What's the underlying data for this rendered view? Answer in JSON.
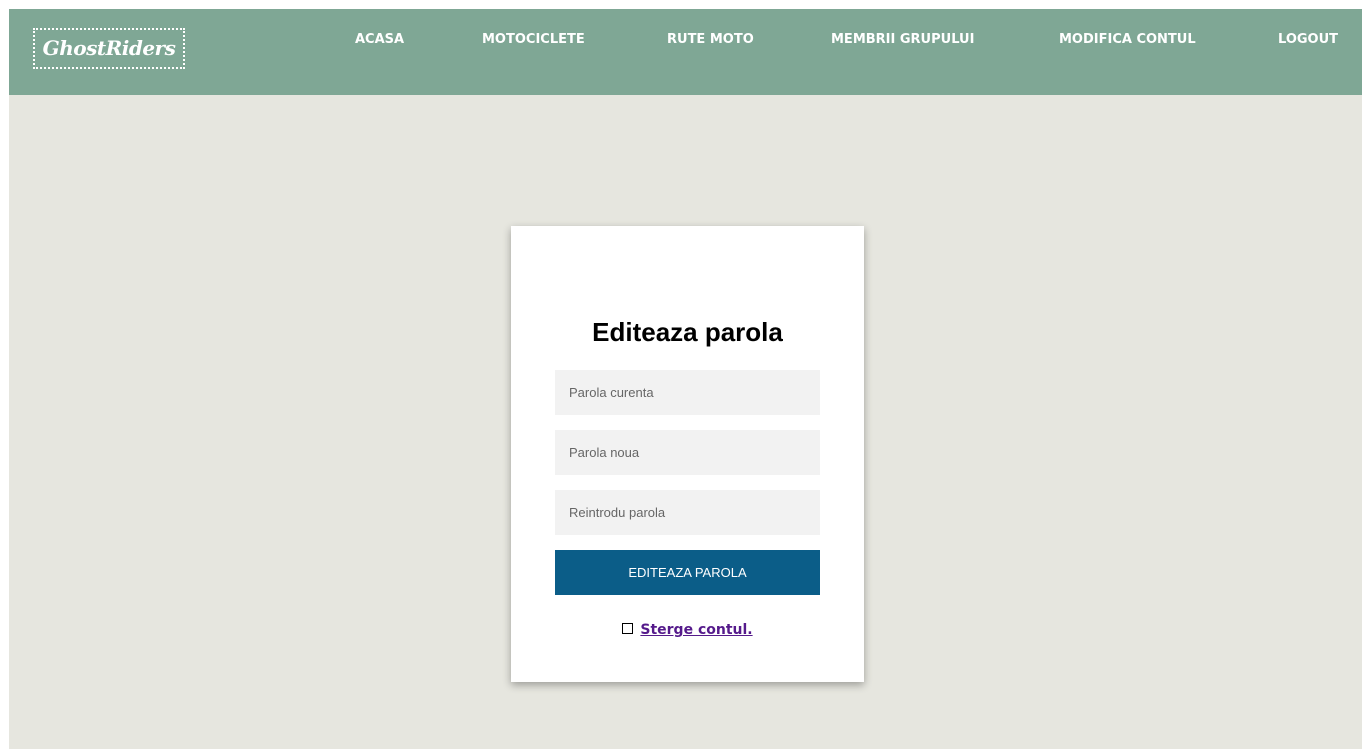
{
  "brand": {
    "logo_text": "GhostRiders"
  },
  "nav": {
    "items": [
      {
        "label": "ACASA"
      },
      {
        "label": "MOTOCICLETE"
      },
      {
        "label": "RUTE MOTO"
      },
      {
        "label": "MEMBRII GRUPULUI"
      },
      {
        "label": "MODIFICA CONTUL"
      },
      {
        "label": "LOGOUT"
      }
    ]
  },
  "form": {
    "title": "Editeaza parola",
    "current_password": {
      "placeholder": "Parola curenta",
      "value": ""
    },
    "new_password": {
      "placeholder": "Parola noua",
      "value": ""
    },
    "repeat_password": {
      "placeholder": "Reintrodu parola",
      "value": ""
    },
    "submit_label": "EDITEAZA PAROLA",
    "delete_link_label": "Sterge contul."
  },
  "colors": {
    "header_bg": "#7fa795",
    "page_bg": "#e6e6df",
    "button_bg": "#0b5d88",
    "link_visited": "#551a8b"
  },
  "icons": {
    "delete_checkbox": "square-outline-icon"
  }
}
